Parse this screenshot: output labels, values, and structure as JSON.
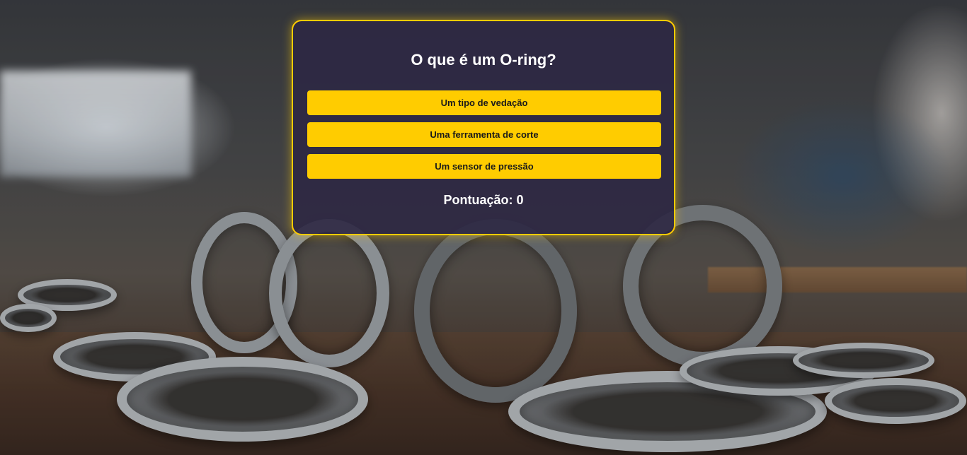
{
  "quiz": {
    "question": "O que é um O-ring?",
    "answers": [
      {
        "label": "Um tipo de vedação"
      },
      {
        "label": "Uma ferramenta de corte"
      },
      {
        "label": "Um sensor de pressão"
      }
    ],
    "score_label": "Pontuação: 0"
  },
  "colors": {
    "accent": "#ffcc00",
    "card_background": "#2d2844",
    "text": "#ffffff",
    "button_text": "#1a1a1a"
  },
  "background": {
    "description_icon": "workshop-metal-rings-photo"
  }
}
